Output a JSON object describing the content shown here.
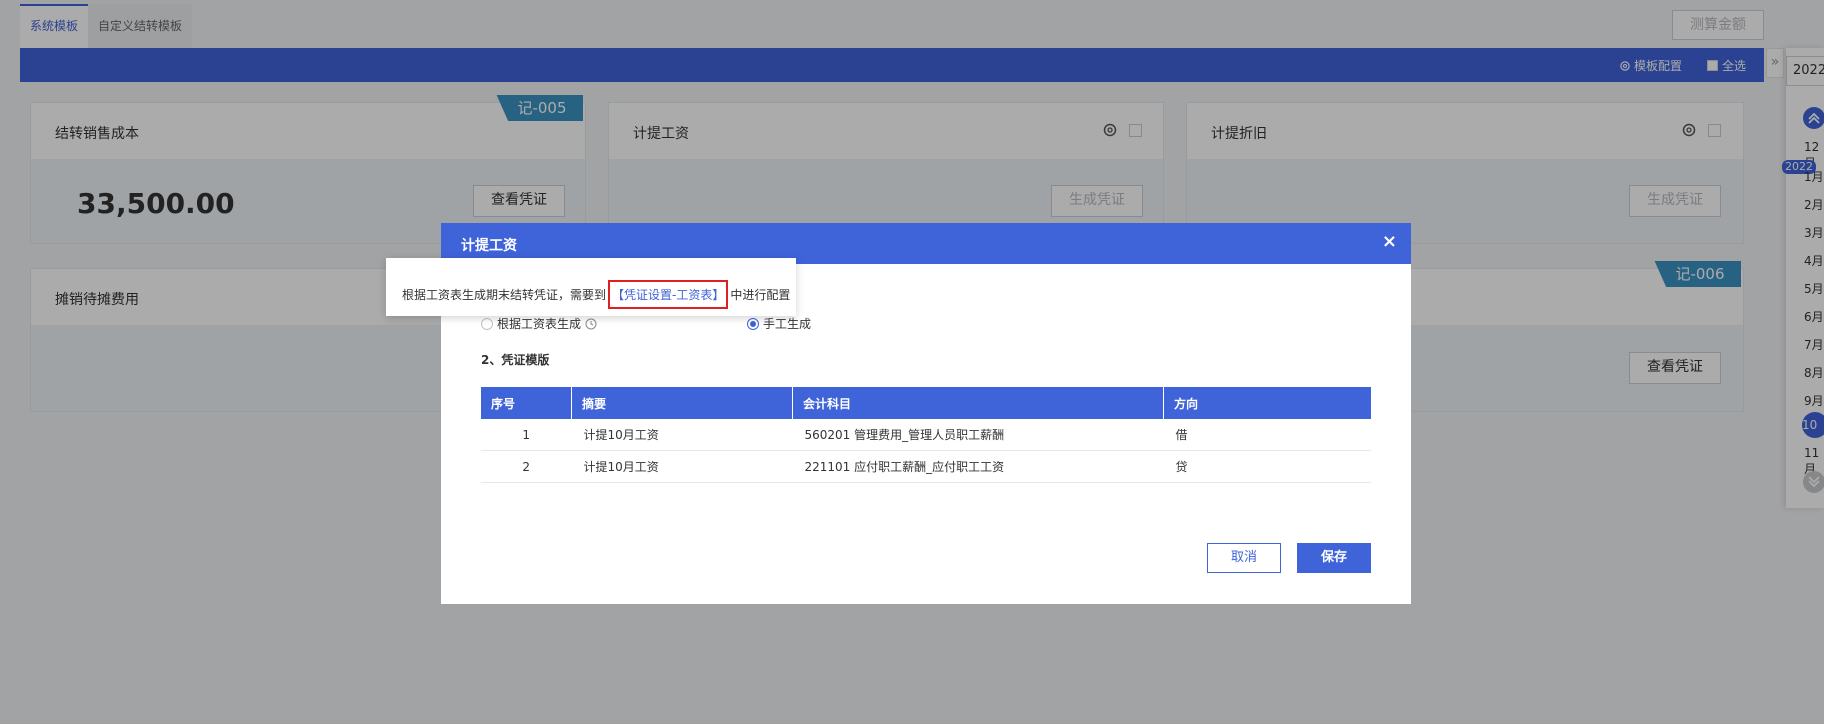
{
  "tabs": [
    {
      "label": "系统模板",
      "active": true
    },
    {
      "label": "自定义结转模板",
      "active": false
    }
  ],
  "toolbar": {
    "calc_label": "测算金额",
    "config_label": "模板配置",
    "select_all_label": "全选"
  },
  "cards": [
    {
      "title": "结转销售成本",
      "amount": "33,500.00",
      "button": "查看凭证",
      "badge": "记-005"
    },
    {
      "title": "计提工资",
      "button": "生成凭证"
    },
    {
      "title": "计提折旧",
      "button": "生成凭证"
    },
    {
      "title": "摊销待摊费用"
    },
    {
      "button": "查看凭证",
      "badge": "记-006"
    }
  ],
  "right_panel": {
    "date_value": "2022-",
    "year_badge": "2022",
    "months": [
      "12月",
      "1月",
      "2月",
      "3月",
      "4月",
      "5月",
      "6月",
      "7月",
      "8月",
      "9月",
      "10月",
      "11月"
    ]
  },
  "modal": {
    "title": "计提工资",
    "close_symbol": "×",
    "option_table": "根据工资表生成",
    "option_manual": "手工生成",
    "section_template": "2、凭证模版",
    "columns": [
      "序号",
      "摘要",
      "会计科目",
      "方向"
    ],
    "rows": [
      {
        "no": "1",
        "summary": "计提10月工资",
        "account": "560201 管理费用_管理人员职工薪酬",
        "direction": "借"
      },
      {
        "no": "2",
        "summary": "计提10月工资",
        "account": "221101 应付职工薪酬_应付职工工资",
        "direction": "贷"
      }
    ],
    "cancel_label": "取消",
    "save_label": "保存"
  },
  "tooltip": {
    "prefix": "根据工资表生成期末结转凭证，需要到",
    "link": "【凭证设置-工资表】",
    "suffix": "中进行配置"
  },
  "colors": {
    "primary": "#3f63d8",
    "ribbon": "#3d92c4",
    "highlight": "#e02020"
  }
}
